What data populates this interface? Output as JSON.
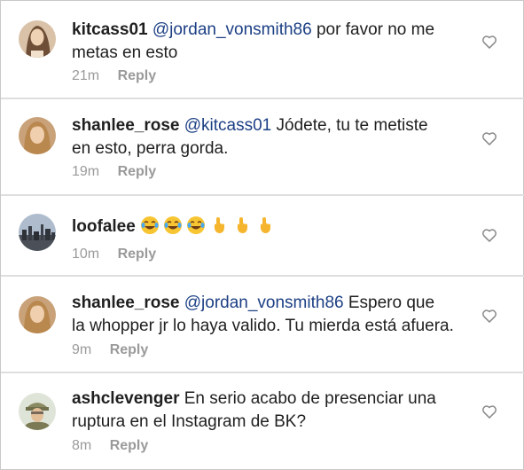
{
  "comments": [
    {
      "username": "kitcass01",
      "mention": "@jordan_vonsmith86",
      "text": " por favor no me",
      "text2": "metas en esto",
      "time": "21m",
      "reply": "Reply"
    },
    {
      "username": "shanlee_rose",
      "mention": "@kitcass01",
      "text": " Jódete, tu te metiste",
      "text2": "en esto, perra gorda.",
      "time": "19m",
      "reply": "Reply"
    },
    {
      "username": "loofalee",
      "emojis": [
        "face-with-tears-of-joy",
        "face-with-tears-of-joy",
        "face-with-tears-of-joy",
        "backhand-index-pointing-up",
        "backhand-index-pointing-up",
        "backhand-index-pointing-up"
      ],
      "time": "10m",
      "reply": "Reply"
    },
    {
      "username": "shanlee_rose",
      "mention": "@jordan_vonsmith86",
      "text": " Espero que",
      "text2": "la whopper jr lo haya valido. Tu mierda está afuera.",
      "time": "9m",
      "reply": "Reply"
    },
    {
      "username": "ashclevenger",
      "text": " En serio acabo de presenciar una",
      "text2": "ruptura en el Instagram de BK?",
      "time": "8m",
      "reply": "Reply"
    }
  ],
  "colors": {
    "mention": "#1c3f84",
    "meta": "#9a9a9a",
    "divider": "#dedede"
  }
}
